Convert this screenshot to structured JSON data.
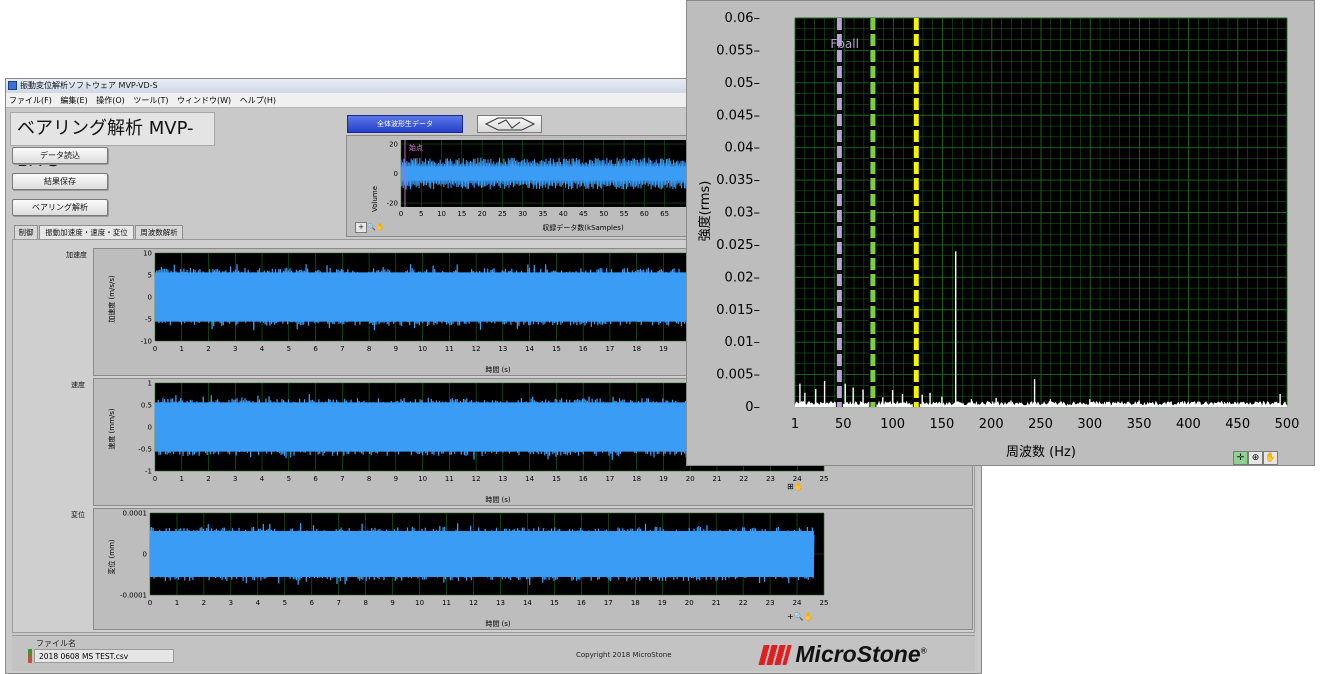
{
  "window": {
    "title": "振動変位解析ソフトウェア MVP-VD-S",
    "menu": [
      "ファイル(F)",
      "編集(E)",
      "操作(O)",
      "ツール(T)",
      "ウィンドウ(W)",
      "ヘルプ(H)"
    ]
  },
  "app": {
    "title": "ベアリング解析 MVP-BA-S",
    "buttons": {
      "load": "データ読込",
      "save": "結果保存",
      "bearing": "ベアリング解析"
    },
    "tabs": [
      "制御",
      "振動加速度・速度・変位",
      "周波数解析"
    ],
    "active_tab": 1
  },
  "overview": {
    "button": "全体波形生データ",
    "start_label": "始点",
    "ylabel": "Volume",
    "xlabel": "収録データ数(kSamples)",
    "ytick_labels": [
      "20",
      "0",
      "-20"
    ],
    "xtick_labels": [
      "0",
      "5",
      "10",
      "15",
      "20",
      "25",
      "30",
      "35",
      "40",
      "45",
      "50",
      "55",
      "60",
      "65"
    ]
  },
  "charts": {
    "accel": {
      "label": "加速度",
      "ylabel": "加速度 (m/s/s)",
      "xlabel": "時間 (s)",
      "ytick_labels": [
        "10",
        "5",
        "0",
        "-5",
        "-10"
      ],
      "ylim": [
        -10,
        10
      ]
    },
    "velocity": {
      "label": "速度",
      "ylabel": "速度 (mm/s)",
      "xlabel": "時間 (s)",
      "ytick_labels": [
        "1",
        "0.5",
        "0",
        "-0.5",
        "-1"
      ],
      "ylim": [
        -1,
        1
      ]
    },
    "displacement": {
      "label": "変位",
      "ylabel": "変位 (mm)",
      "xlabel": "時間 (s)",
      "ytick_labels": [
        "0.0001",
        "0",
        "-0.0001"
      ],
      "ylim": [
        -0.0001,
        0.0001
      ]
    },
    "time_ticks": [
      "0",
      "1",
      "2",
      "3",
      "4",
      "5",
      "6",
      "7",
      "8",
      "9",
      "10",
      "11",
      "12",
      "13",
      "14",
      "15",
      "16",
      "17",
      "18",
      "19",
      "20",
      "21",
      "22",
      "23",
      "24",
      "25"
    ]
  },
  "status": {
    "file_label": "ファイル名",
    "file_path": "2018 0608 MS TEST.csv",
    "copyright": "Copyright 2018 MicroStone",
    "logo": "MicroStone"
  },
  "colors": {
    "signal": "#3a9cf5",
    "grid": "#1f6b1f",
    "plot_bg": "#000000",
    "fball": "#b9a2d6",
    "marker_green": "#7ad13a",
    "marker_yellow": "#f7f200"
  },
  "chart_data": {
    "type": "line",
    "title": "",
    "xlabel": "周波数 (Hz)",
    "ylabel": "強度(rms)",
    "xlim": [
      1,
      500
    ],
    "ylim": [
      0,
      0.06
    ],
    "xtick_labels": [
      "1",
      "50",
      "100",
      "150",
      "200",
      "250",
      "300",
      "350",
      "400",
      "450",
      "500"
    ],
    "ytick_labels": [
      "0.06",
      "0.055",
      "0.05",
      "0.045",
      "0.04",
      "0.035",
      "0.03",
      "0.025",
      "0.02",
      "0.015",
      "0.01",
      "0.005",
      "0"
    ],
    "grid": true,
    "annotations": [
      {
        "text": "Fball",
        "x": 45
      }
    ],
    "marker_lines": [
      {
        "x": 46,
        "color": "#b9a2d6"
      },
      {
        "x": 80,
        "color": "#7ad13a"
      },
      {
        "x": 124,
        "color": "#f7f200"
      }
    ],
    "series": [
      {
        "x": [
          6,
          11,
          22,
          31,
          46,
          52,
          60,
          70,
          78,
          82,
          90,
          100,
          110,
          124,
          130,
          138,
          150,
          164,
          180,
          205,
          220,
          244,
          260,
          300,
          350,
          400,
          440,
          470,
          493,
          498
        ],
        "values": [
          0.0036,
          0.0022,
          0.0028,
          0.004,
          0.005,
          0.0036,
          0.003,
          0.0027,
          0.004,
          0.002,
          0.0015,
          0.0026,
          0.002,
          0.0036,
          0.0019,
          0.0022,
          0.0016,
          0.024,
          0.0012,
          0.0014,
          0.001,
          0.0043,
          0.0012,
          0.0012,
          0.001,
          0.0008,
          0.0006,
          0.0006,
          0.002,
          0.0008
        ]
      }
    ]
  }
}
